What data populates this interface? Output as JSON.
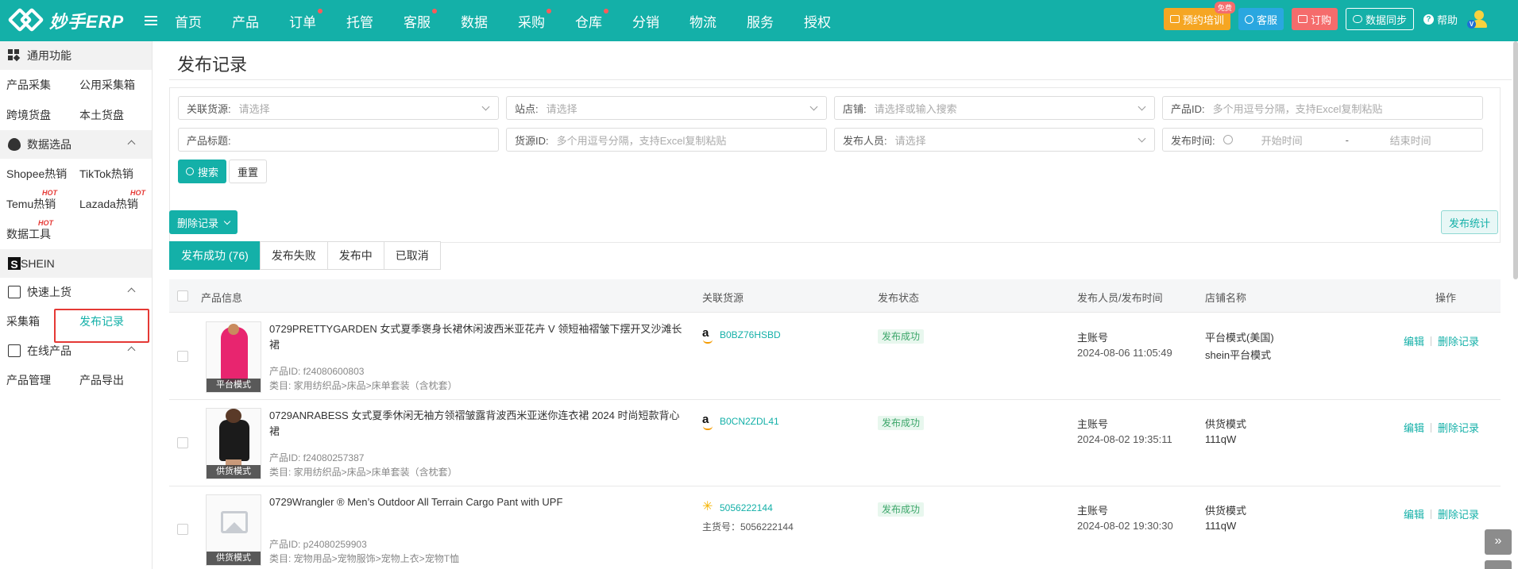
{
  "app": {
    "logo_text": "妙手ERP"
  },
  "nav": [
    {
      "label": "首页",
      "dot": false
    },
    {
      "label": "产品",
      "dot": false
    },
    {
      "label": "订单",
      "dot": true
    },
    {
      "label": "托管",
      "dot": false
    },
    {
      "label": "客服",
      "dot": true
    },
    {
      "label": "数据",
      "dot": false
    },
    {
      "label": "采购",
      "dot": true
    },
    {
      "label": "仓库",
      "dot": true
    },
    {
      "label": "分销",
      "dot": false
    },
    {
      "label": "物流",
      "dot": false
    },
    {
      "label": "服务",
      "dot": false
    },
    {
      "label": "授权",
      "dot": false
    }
  ],
  "topright": {
    "training": "预约培训",
    "free_badge": "免费",
    "service": "客服",
    "order": "订购",
    "sync": "数据同步",
    "help": "帮助"
  },
  "sidebar": {
    "general": {
      "title": "通用功能",
      "items": [
        "产品采集",
        "公用采集箱",
        "跨境货盘",
        "本土货盘"
      ]
    },
    "data_select": {
      "title": "数据选品",
      "items": [
        "Shopee热销",
        "TikTok热销",
        "Temu热销",
        "Lazada热销",
        "数据工具"
      ],
      "hot": "HOT"
    },
    "shein": {
      "title": "SHEIN",
      "icon_letter": "S"
    },
    "quick": {
      "title": "快速上货",
      "items": [
        "采集箱",
        "发布记录"
      ]
    },
    "online": {
      "title": "在线产品",
      "items": [
        "产品管理",
        "产品导出"
      ]
    }
  },
  "page": {
    "title": "发布记录",
    "filters": {
      "source": {
        "label": "关联货源:",
        "placeholder": "请选择"
      },
      "site": {
        "label": "站点:",
        "placeholder": "请选择"
      },
      "shop": {
        "label": "店铺:",
        "placeholder": "请选择或输入搜索"
      },
      "product_id": {
        "label": "产品ID:",
        "placeholder": "多个用逗号分隔，支持Excel复制粘贴"
      },
      "product_title": {
        "label": "产品标题:",
        "placeholder": ""
      },
      "source_id": {
        "label": "货源ID:",
        "placeholder": "多个用逗号分隔，支持Excel复制粘贴"
      },
      "publisher": {
        "label": "发布人员:",
        "placeholder": "请选择"
      },
      "publish_time": {
        "label": "发布时间:",
        "start": "开始时间",
        "sep": "-",
        "end": "结束时间"
      }
    },
    "search_btn": "搜索",
    "reset_btn": "重置",
    "delete_btn": "删除记录",
    "stats_btn": "发布统计",
    "tabs": [
      "发布成功 (76)",
      "发布失败",
      "发布中",
      "已取消"
    ],
    "columns": [
      "产品信息",
      "关联货源",
      "发布状态",
      "发布人员/发布时间",
      "店铺名称",
      "操作"
    ],
    "rows": [
      {
        "title": "0729PRETTYGARDEN 女式夏季褒身长裙休闲波西米亚花卉 V 领短袖褶皱下摆开叉沙滩长裙",
        "mode": "平台模式",
        "pid": "产品ID: f24080600803",
        "category": "类目: 家用纺织品>床品>床单套装（含枕套）",
        "source_icon": "amazon",
        "source_id": "B0BZ76HSBD",
        "source_main": "",
        "status": "发布成功",
        "publisher": "主账号",
        "time": "2024-08-06 11:05:49",
        "shop1": "平台模式(美国)",
        "shop2": "shein平台模式",
        "edit": "编辑",
        "delete": "删除记录"
      },
      {
        "title": "0729ANRABESS 女式夏季休闲无袖方领褶皱露背波西米亚迷你连衣裙 2024 时尚短款背心裙",
        "mode": "供货模式",
        "pid": "产品ID: f24080257387",
        "category": "类目: 家用纺织品>床品>床单套装（含枕套）",
        "source_icon": "amazon",
        "source_id": "B0CN2ZDL41",
        "source_main": "",
        "status": "发布成功",
        "publisher": "主账号",
        "time": "2024-08-02 19:35:11",
        "shop1": "供货模式",
        "shop2": "111qW",
        "edit": "编辑",
        "delete": "删除记录"
      },
      {
        "title": "0729Wrangler ® Men’s Outdoor All Terrain Cargo Pant with UPF",
        "mode": "供货模式",
        "pid": "产品ID: p24080259903",
        "category": "类目: 宠物用品>宠物服饰>宠物上衣>宠物T恤",
        "source_icon": "walmart",
        "source_id": "5056222144",
        "source_main": "主货号：5056222144",
        "status": "发布成功",
        "publisher": "主账号",
        "time": "2024-08-02 19:30:30",
        "shop1": "供货模式",
        "shop2": "111qW",
        "edit": "编辑",
        "delete": "删除记录"
      }
    ]
  }
}
